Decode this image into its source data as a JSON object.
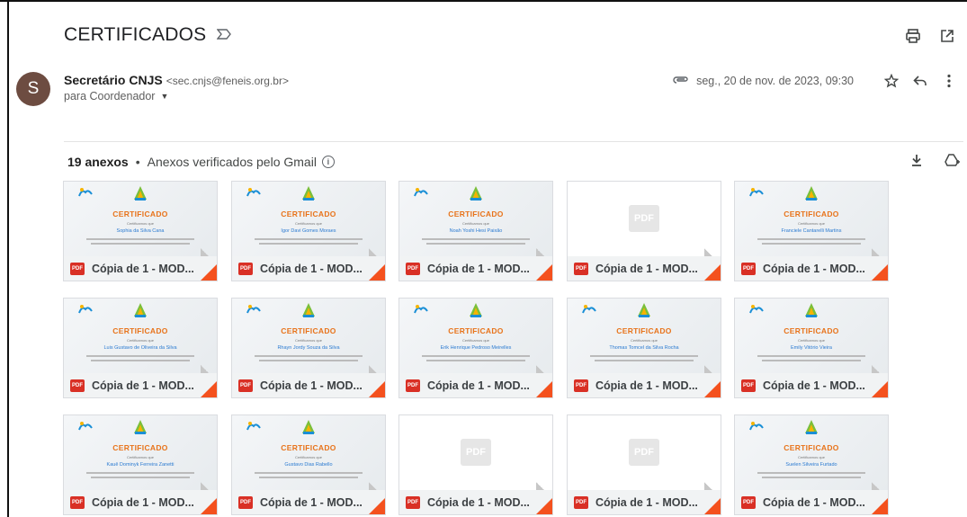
{
  "header": {
    "subject": "CERTIFICADOS",
    "icons": [
      "printer-icon",
      "open-in-new-icon"
    ]
  },
  "message": {
    "avatar_letter": "S",
    "sender_name": "Secretário CNJS",
    "sender_email": "<sec.cnjs@feneis.org.br>",
    "recipient": "para Coordenador",
    "date": "seg., 20 de nov. de 2023, 09:30"
  },
  "attachments": {
    "count_label": "19 anexos",
    "separator": "•",
    "verified_label": "Anexos verificados pelo Gmail",
    "pdf_ghost": "PDF",
    "pdf_badge": "PDF",
    "items": [
      {
        "file": "Cópia de 1 - MOD...",
        "title": "CERTIFICADO",
        "sub": "Certificamos que",
        "name": "Sophia da Silva Cana"
      },
      {
        "file": "Cópia de 1 - MOD...",
        "title": "CERTIFICADO",
        "sub": "Certificamos que",
        "name": "Igor Davi Gomes Moraes"
      },
      {
        "file": "Cópia de 1 - MOD...",
        "title": "CERTIFICADO",
        "sub": "Certificamos que",
        "name": "Noah Yoshi Hesi Paixão"
      },
      {
        "file": "Cópia de 1 - MOD...",
        "title": "",
        "sub": "",
        "name": ""
      },
      {
        "file": "Cópia de 1 - MOD...",
        "title": "CERTIFICADO",
        "sub": "Certificamos que",
        "name": "Franciele Cantarelli Martins"
      },
      {
        "file": "Cópia de 1 - MOD...",
        "title": "CERTIFICADO",
        "sub": "Certificamos que",
        "name": "Luis Gustavo de Oliveira da Silva"
      },
      {
        "file": "Cópia de 1 - MOD...",
        "title": "CERTIFICADO",
        "sub": "Certificamos que",
        "name": "Rhayn Jordy Souza da Silva"
      },
      {
        "file": "Cópia de 1 - MOD...",
        "title": "CERTIFICADO",
        "sub": "Certificamos que",
        "name": "Erik Henrique Pedroso Meirelles"
      },
      {
        "file": "Cópia de 1 - MOD...",
        "title": "CERTIFICADO",
        "sub": "Certificamos que",
        "name": "Thomas Tomcel da Silva Rocha"
      },
      {
        "file": "Cópia de 1 - MOD...",
        "title": "CERTIFICADO",
        "sub": "Certificamos que",
        "name": "Emily Vitório Vieira"
      },
      {
        "file": "Cópia de 1 - MOD...",
        "title": "CERTIFICADO",
        "sub": "Certificamos que",
        "name": "Kauê Dominyk Ferreira Zanetti"
      },
      {
        "file": "Cópia de 1 - MOD...",
        "title": "CERTIFICADO",
        "sub": "Certificamos que",
        "name": "Gustavo Dias Rabello"
      },
      {
        "file": "Cópia de 1 - MOD...",
        "title": "",
        "sub": "",
        "name": ""
      },
      {
        "file": "Cópia de 1 - MOD...",
        "title": "",
        "sub": "",
        "name": ""
      },
      {
        "file": "Cópia de 1 - MOD...",
        "title": "CERTIFICADO",
        "sub": "Certificamos que",
        "name": "Suelen Silveira Furtado"
      }
    ]
  },
  "colors": {
    "avatar": "#6d4c41",
    "pdf_red": "#d93025",
    "fold_orange": "#f4511e",
    "cert_orange": "#e8731a",
    "cert_blue": "#2a7ad1"
  }
}
